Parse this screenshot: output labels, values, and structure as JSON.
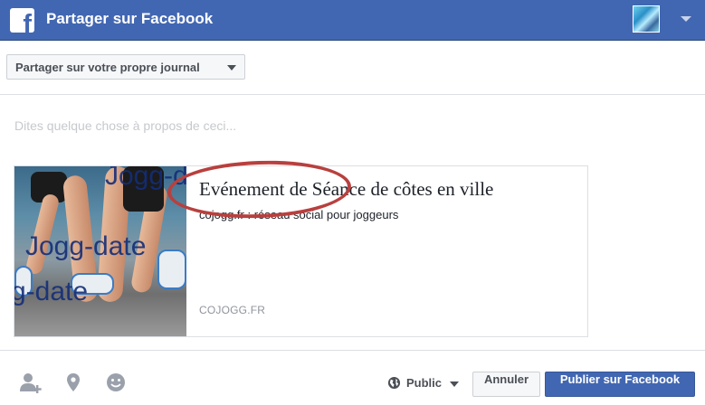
{
  "header": {
    "title": "Partager sur Facebook",
    "logo_icon": "facebook-f-icon",
    "avatar_icon": "user-avatar",
    "menu_icon": "chevron-down-icon",
    "bg_color": "#4267b2"
  },
  "share_target": {
    "selected": "Partager sur votre propre journal",
    "icon": "caret-down-icon"
  },
  "composer": {
    "placeholder": "Dites quelque chose à propos de ceci...",
    "value": ""
  },
  "preview": {
    "image_watermark_1": "Jogg-date",
    "image_watermark_2": "Jogg-date",
    "image_watermark_3": "g-date",
    "title": "Evénement de Séance de côtes en ville",
    "description": "cojogg.fr : réseau social pour joggeurs",
    "domain": "COJOGG.FR",
    "annotation_color": "#b8403e"
  },
  "footer": {
    "icons": [
      "tag-friends-icon",
      "location-pin-icon",
      "emoji-icon"
    ],
    "audience_label": "Public",
    "audience_icon": "globe-icon",
    "cancel_label": "Annuler",
    "publish_label": "Publier sur Facebook",
    "publish_color": "#4267b2"
  }
}
